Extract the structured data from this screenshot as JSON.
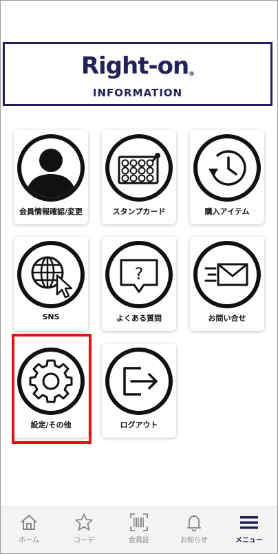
{
  "header": {
    "logo": "Right-on",
    "logo_mark": "®",
    "info_label": "INFORMATION"
  },
  "menu": {
    "tiles": [
      {
        "label": "会員情報確認/変更",
        "icon": "person-icon"
      },
      {
        "label": "スタンプカード",
        "icon": "stamp-card-icon"
      },
      {
        "label": "購入アイテム",
        "icon": "history-clock-icon"
      },
      {
        "label": "SNS",
        "icon": "globe-cursor-icon"
      },
      {
        "label": "よくある質問",
        "icon": "question-bubble-icon"
      },
      {
        "label": "お問い合せ",
        "icon": "mail-icon"
      },
      {
        "label": "設定/その他",
        "icon": "gear-icon"
      },
      {
        "label": "ログアウト",
        "icon": "logout-icon"
      }
    ],
    "highlighted": "設定/その他"
  },
  "bottom_nav": {
    "items": [
      {
        "label": "ホーム",
        "icon": "home-icon"
      },
      {
        "label": "コーデ",
        "icon": "star-icon"
      },
      {
        "label": "会員証",
        "icon": "barcode-icon"
      },
      {
        "label": "お知らせ",
        "icon": "bell-icon"
      },
      {
        "label": "メニュー",
        "icon": "hamburger-menu-icon"
      }
    ],
    "active": "メニュー"
  },
  "colors": {
    "brand": "#232158",
    "highlight": "#e11414",
    "icon": "#111111",
    "nav_inactive": "#888888",
    "nav_bg": "#f3f3f3"
  }
}
